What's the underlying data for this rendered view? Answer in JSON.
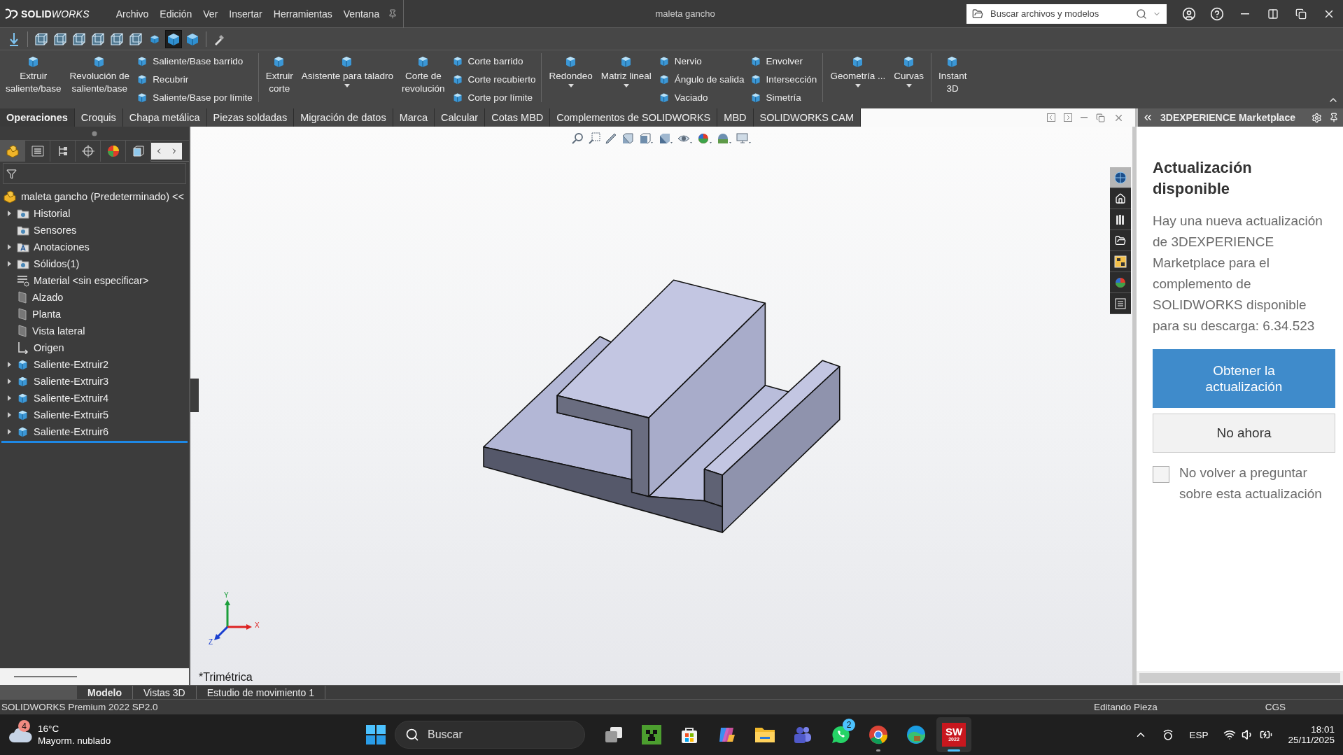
{
  "app": {
    "logo_strong": "SOLID",
    "logo_light": "WORKS",
    "menu": [
      "Archivo",
      "Edición",
      "Ver",
      "Insertar",
      "Herramientas",
      "Ventana"
    ],
    "document_title": "maleta gancho",
    "search": {
      "placeholder": "Buscar archivos y modelos"
    }
  },
  "view_toolbar": [
    {
      "kind": "arrow",
      "selected": false
    },
    {
      "kind": "wire",
      "selected": false
    },
    {
      "kind": "wire",
      "selected": false
    },
    {
      "kind": "wire",
      "selected": false
    },
    {
      "kind": "wire",
      "selected": false
    },
    {
      "kind": "wire",
      "selected": false
    },
    {
      "kind": "wire",
      "selected": false
    },
    {
      "kind": "small",
      "selected": false
    },
    {
      "kind": "shaded",
      "selected": true
    },
    {
      "kind": "shaded",
      "selected": false
    },
    {
      "kind": "brush",
      "selected": false
    }
  ],
  "ribbon": [
    {
      "kind": "large",
      "label": "Extruir\nsaliente/base",
      "has_menu": false
    },
    {
      "kind": "large",
      "label": "Revolución de\nsaliente/base",
      "has_menu": false
    },
    {
      "kind": "stack",
      "items": [
        "Saliente/Base barrido",
        "Recubrir",
        "Saliente/Base por límite"
      ]
    },
    {
      "kind": "separator"
    },
    {
      "kind": "large",
      "label": "Extruir\ncorte",
      "has_menu": false
    },
    {
      "kind": "large",
      "label": "Asistente para taladro",
      "has_menu": true
    },
    {
      "kind": "large",
      "label": "Corte de\nrevolución",
      "has_menu": false
    },
    {
      "kind": "stack",
      "items": [
        "Corte barrido",
        "Corte recubierto",
        "Corte por límite"
      ]
    },
    {
      "kind": "separator"
    },
    {
      "kind": "large",
      "label": "Redondeo",
      "has_menu": true
    },
    {
      "kind": "large",
      "label": "Matriz lineal",
      "has_menu": true
    },
    {
      "kind": "stack",
      "items": [
        "Nervio",
        "Ángulo de salida",
        "Vaciado"
      ]
    },
    {
      "kind": "stack",
      "items": [
        "Envolver",
        "Intersección",
        "Simetría"
      ]
    },
    {
      "kind": "separator"
    },
    {
      "kind": "large",
      "label": "Geometría ...",
      "has_menu": true
    },
    {
      "kind": "large",
      "label": "Curvas",
      "has_menu": true
    },
    {
      "kind": "separator"
    },
    {
      "kind": "large",
      "label": "Instant\n3D",
      "has_menu": false
    }
  ],
  "tabs": [
    {
      "label": "Operaciones",
      "selected": true
    },
    {
      "label": "Croquis",
      "selected": false
    },
    {
      "label": "Chapa metálica",
      "selected": false
    },
    {
      "label": "Piezas soldadas",
      "selected": false
    },
    {
      "label": "Migración de datos",
      "selected": false
    },
    {
      "label": "Marca",
      "selected": false
    },
    {
      "label": "Calcular",
      "selected": false
    },
    {
      "label": "Cotas MBD",
      "selected": false
    },
    {
      "label": "Complementos de SOLIDWORKS",
      "selected": false
    },
    {
      "label": "MBD",
      "selected": false
    },
    {
      "label": "SOLIDWORKS CAM",
      "selected": false
    }
  ],
  "manager_tabs": [
    {
      "kind": "feature",
      "selected": true
    },
    {
      "kind": "property",
      "selected": false
    },
    {
      "kind": "config",
      "selected": false
    },
    {
      "kind": "target",
      "selected": false
    },
    {
      "kind": "display",
      "selected": false
    },
    {
      "kind": "cam",
      "selected": false
    }
  ],
  "tree": {
    "root": "maleta gancho (Predeterminado) <<",
    "items": [
      {
        "label": "Historial",
        "kind": "folder",
        "expandable": true
      },
      {
        "label": "Sensores",
        "kind": "folder",
        "expandable": false
      },
      {
        "label": "Anotaciones",
        "kind": "annotation",
        "expandable": true
      },
      {
        "label": "Sólidos(1)",
        "kind": "folder",
        "expandable": true
      },
      {
        "label": "Material <sin especificar>",
        "kind": "material",
        "expandable": false
      },
      {
        "label": "Alzado",
        "kind": "plane",
        "expandable": false
      },
      {
        "label": "Planta",
        "kind": "plane",
        "expandable": false
      },
      {
        "label": "Vista lateral",
        "kind": "plane",
        "expandable": false
      },
      {
        "label": "Origen",
        "kind": "origin",
        "expandable": false
      },
      {
        "label": "Saliente-Extruir2",
        "kind": "feature",
        "expandable": true
      },
      {
        "label": "Saliente-Extruir3",
        "kind": "feature",
        "expandable": true
      },
      {
        "label": "Saliente-Extruir4",
        "kind": "feature",
        "expandable": true
      },
      {
        "label": "Saliente-Extruir5",
        "kind": "feature",
        "expandable": true
      },
      {
        "label": "Saliente-Extruir6",
        "kind": "feature",
        "expandable": true
      }
    ]
  },
  "viewport": {
    "view_name": "*Trimétrica",
    "triad": {
      "x": "X",
      "y": "Y",
      "z": "Z"
    }
  },
  "taskpane_tabs": [
    {
      "kind": "globe",
      "selected": true
    },
    {
      "kind": "home",
      "selected": false
    },
    {
      "kind": "parts",
      "selected": false
    },
    {
      "kind": "folder",
      "selected": false
    },
    {
      "kind": "palette",
      "selected": false
    },
    {
      "kind": "appearance",
      "selected": false
    },
    {
      "kind": "list",
      "selected": false
    }
  ],
  "taskpane": {
    "title": "3DEXPERIENCE Marketplace",
    "heading": "Actualización disponible",
    "body": "Hay una nueva actualización de 3DEXPERIENCE Marketplace para el complemento de SOLIDWORKS disponible para su descarga: 6.34.523",
    "primary_button": "Obtener la actualización",
    "secondary_button": "No ahora",
    "checkbox": {
      "label": "No volver a preguntar sobre esta actualización",
      "checked": false
    }
  },
  "bottom_tabs": [
    {
      "label": "Modelo",
      "selected": true
    },
    {
      "label": "Vistas 3D",
      "selected": false
    },
    {
      "label": "Estudio de movimiento 1",
      "selected": false
    }
  ],
  "status_bar": {
    "product": "SOLIDWORKS Premium 2022 SP2.0",
    "mode": "Editando Pieza",
    "units": "CGS"
  },
  "taskbar": {
    "weather": {
      "badge": "4",
      "temperature": "16°C",
      "description": "Mayorm. nublado"
    },
    "search": {
      "placeholder": "Buscar"
    },
    "apps": [
      {
        "kind": "taskview",
        "running": false,
        "active": false
      },
      {
        "kind": "blocks",
        "running": false,
        "active": false
      },
      {
        "kind": "store",
        "running": false,
        "active": false
      },
      {
        "kind": "swirl",
        "running": false,
        "active": false
      },
      {
        "kind": "folder",
        "running": false,
        "active": false
      },
      {
        "kind": "people",
        "running": false,
        "active": false
      },
      {
        "kind": "chat",
        "badge": "2",
        "running": false,
        "active": false
      },
      {
        "kind": "ring",
        "running": true,
        "active": false
      },
      {
        "kind": "wave",
        "running": false,
        "active": false
      },
      {
        "kind": "sw",
        "logo_text": "SW",
        "logo_sub": "2022",
        "running": true,
        "active": true
      }
    ],
    "language": "ESP",
    "time": "18:01",
    "date": "25/11/2025"
  }
}
